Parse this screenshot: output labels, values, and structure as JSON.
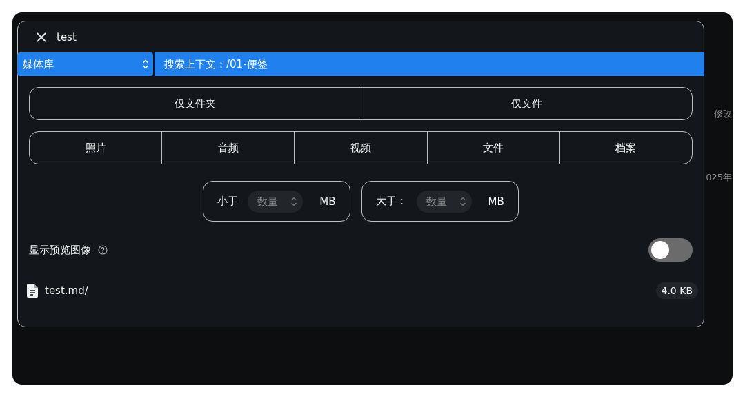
{
  "background": {
    "texts": [
      "修改",
      "025年"
    ]
  },
  "dialog": {
    "title": "test",
    "scope_select": {
      "value": "媒体库"
    },
    "search_context": "搜索上下文：/01-便签",
    "type_toggle": [
      {
        "label": "仅文件夹",
        "selected": false
      },
      {
        "label": "仅文件",
        "selected": false
      }
    ],
    "media_types": [
      {
        "label": "照片",
        "selected": false
      },
      {
        "label": "音频",
        "selected": false
      },
      {
        "label": "视频",
        "selected": false
      },
      {
        "label": "文件",
        "selected": false
      },
      {
        "label": "档案",
        "selected": false
      }
    ],
    "size_filters": [
      {
        "label": "小于",
        "placeholder": "数量",
        "unit": "MB"
      },
      {
        "label": "大于：",
        "placeholder": "数量",
        "unit": "MB"
      }
    ],
    "preview": {
      "label": "显示预览图像",
      "on": false
    },
    "results": [
      {
        "name": "test.md/",
        "size": "4.0 KB"
      }
    ]
  }
}
